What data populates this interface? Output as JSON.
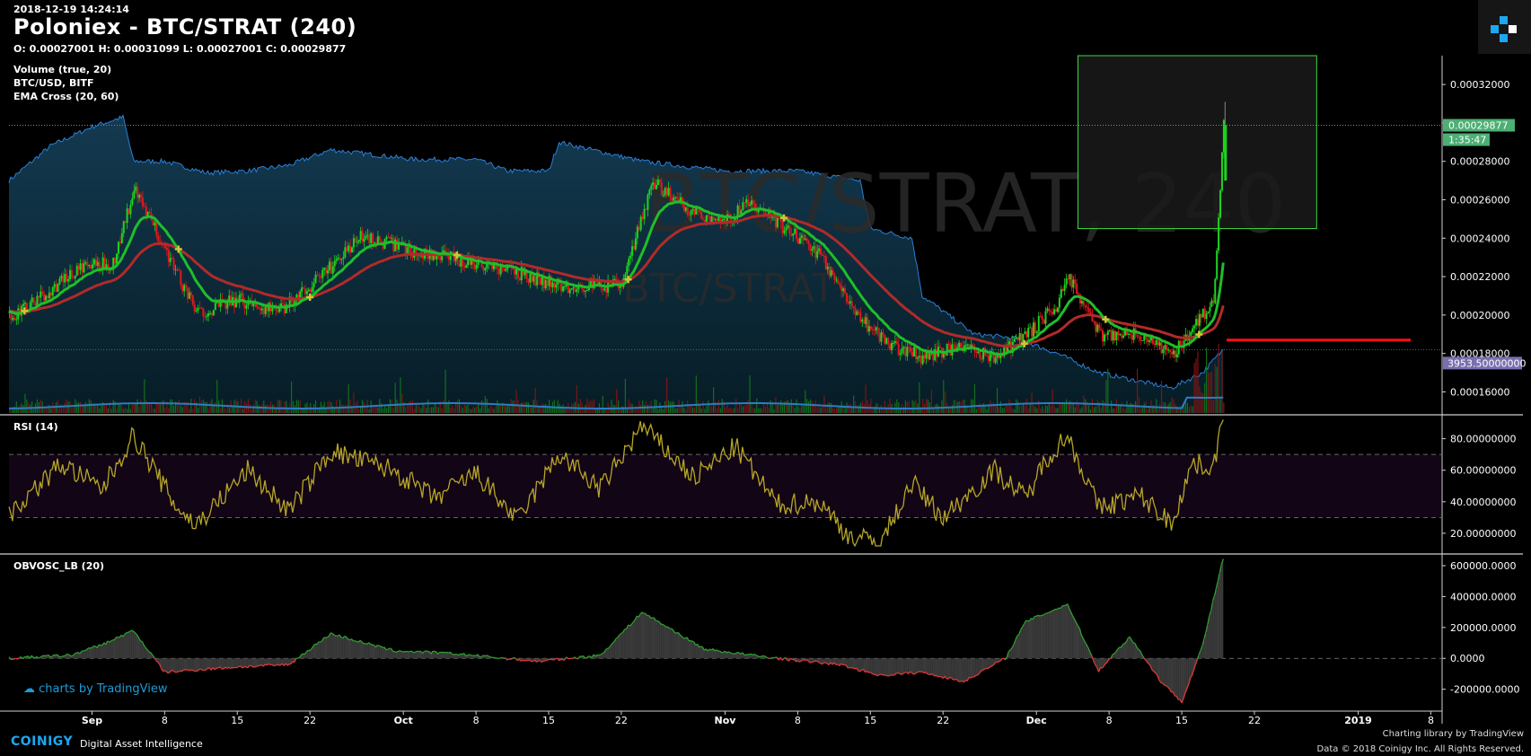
{
  "header": {
    "timestamp": "2018-12-19 14:24:14",
    "title": "Poloniex - BTC/STRAT (240)",
    "ohlc": "O: 0.00027001 H: 0.00031099 L: 0.00027001 C: 0.00029877"
  },
  "indicators": {
    "volume": "Volume (true, 20)",
    "overlay": "BTC/USD, BITF",
    "ema": "EMA Cross (20, 60)",
    "rsi": "RSI (14)",
    "obv": "OBVOSC_LB (20)"
  },
  "watermark": {
    "big": "BTC/STRAT, 240",
    "small": "BTC/STRAT"
  },
  "labels": {
    "last_price": "0.00029877",
    "countdown": "1:35:47",
    "overlay_value": "3953.50000000"
  },
  "footer": {
    "brand": "COINIGY",
    "tagline": "Digital Asset Intelligence",
    "charting_library": "Charting library by  TradingView",
    "copyright": "Data © 2018  Coinigy Inc. All Rights Reserved.",
    "tv_badge": "charts by TradingView"
  },
  "colors": {
    "background": "#000000",
    "up": "#1ed31e",
    "down": "#e0191c",
    "ema_fast": "#1fbe2a",
    "ema_slow": "#b22a2a",
    "overlay_line": "#2b7fd6",
    "rsi_line": "#b7a628",
    "highlight_box": "#3ddc3d",
    "resistance": "#ff1010",
    "price_label": "#4caf73",
    "overlay_label": "#7a6fae"
  },
  "chart_data": [
    {
      "type": "candlestick",
      "title": "Poloniex - BTC/STRAT (240)",
      "x_ticks": [
        "Sep",
        "8",
        "15",
        "22",
        "Oct",
        "8",
        "15",
        "22",
        "Nov",
        "8",
        "15",
        "22",
        "Dec",
        "8",
        "15",
        "22",
        "2019",
        "8"
      ],
      "y_ticks": [
        "0.00032000",
        "0.00030000",
        "0.00028000",
        "0.00026000",
        "0.00024000",
        "0.00022000",
        "0.00020000",
        "0.00018000",
        "0.00016000"
      ],
      "ylim": [
        0.000149,
        0.000335
      ],
      "x_range": [
        "2018-08-24",
        "2019-01-09"
      ],
      "close_anchors": [
        {
          "x": "2018-08-25",
          "y": 0.000201
        },
        {
          "x": "2018-08-31",
          "y": 0.000225
        },
        {
          "x": "2018-09-03",
          "y": 0.000227
        },
        {
          "x": "2018-09-05",
          "y": 0.000265
        },
        {
          "x": "2018-09-08",
          "y": 0.000235
        },
        {
          "x": "2018-09-11",
          "y": 0.000201
        },
        {
          "x": "2018-09-15",
          "y": 0.000208
        },
        {
          "x": "2018-09-19",
          "y": 0.000202
        },
        {
          "x": "2018-09-23",
          "y": 0.00022
        },
        {
          "x": "2018-09-27",
          "y": 0.000241
        },
        {
          "x": "2018-10-02",
          "y": 0.000233
        },
        {
          "x": "2018-10-08",
          "y": 0.000227
        },
        {
          "x": "2018-10-12",
          "y": 0.000222
        },
        {
          "x": "2018-10-16",
          "y": 0.000215
        },
        {
          "x": "2018-10-22",
          "y": 0.000215
        },
        {
          "x": "2018-10-25",
          "y": 0.00027
        },
        {
          "x": "2018-10-28",
          "y": 0.000256
        },
        {
          "x": "2018-11-01",
          "y": 0.000248
        },
        {
          "x": "2018-11-03",
          "y": 0.000258
        },
        {
          "x": "2018-11-06",
          "y": 0.000248
        },
        {
          "x": "2018-11-10",
          "y": 0.000232
        },
        {
          "x": "2018-11-14",
          "y": 0.000198
        },
        {
          "x": "2018-11-17",
          "y": 0.000184
        },
        {
          "x": "2018-11-20",
          "y": 0.000178
        },
        {
          "x": "2018-11-23",
          "y": 0.000183
        },
        {
          "x": "2018-11-27",
          "y": 0.000178
        },
        {
          "x": "2018-11-30",
          "y": 0.00019
        },
        {
          "x": "2018-12-03",
          "y": 0.000205
        },
        {
          "x": "2018-12-04",
          "y": 0.000221
        },
        {
          "x": "2018-12-07",
          "y": 0.00019
        },
        {
          "x": "2018-12-11",
          "y": 0.00019
        },
        {
          "x": "2018-12-14",
          "y": 0.000179
        },
        {
          "x": "2018-12-17",
          "y": 0.0002
        },
        {
          "x": "2018-12-18",
          "y": 0.000206
        },
        {
          "x": "2018-12-19",
          "y": 0.000299
        }
      ],
      "last_price": 0.00029877,
      "resistance_level": 0.000187,
      "highlight_zone": {
        "x_from": "2018-12-05",
        "x_to": "2018-12-28",
        "y_from": 0.000245,
        "y_to": 0.000335
      }
    },
    {
      "type": "line",
      "name": "BTC/USD, BITF",
      "last_value": 3953.5,
      "note": "scaled overlay of BTC/USD price drawn on the price pane"
    },
    {
      "type": "line",
      "title": "RSI (14)",
      "y_ticks": [
        "80.00000000",
        "60.00000000",
        "40.00000000",
        "20.00000000"
      ],
      "ylim": [
        8,
        94
      ],
      "bands": [
        30,
        70
      ],
      "anchors": [
        {
          "x": "2018-08-24",
          "y": 32
        },
        {
          "x": "2018-08-29",
          "y": 64
        },
        {
          "x": "2018-09-02",
          "y": 48
        },
        {
          "x": "2018-09-05",
          "y": 82
        },
        {
          "x": "2018-09-09",
          "y": 38
        },
        {
          "x": "2018-09-11",
          "y": 25
        },
        {
          "x": "2018-09-16",
          "y": 60
        },
        {
          "x": "2018-09-20",
          "y": 34
        },
        {
          "x": "2018-09-24",
          "y": 72
        },
        {
          "x": "2018-09-30",
          "y": 60
        },
        {
          "x": "2018-10-04",
          "y": 42
        },
        {
          "x": "2018-10-08",
          "y": 58
        },
        {
          "x": "2018-10-12",
          "y": 28
        },
        {
          "x": "2018-10-16",
          "y": 70
        },
        {
          "x": "2018-10-20",
          "y": 48
        },
        {
          "x": "2018-10-24",
          "y": 88
        },
        {
          "x": "2018-10-29",
          "y": 55
        },
        {
          "x": "2018-11-02",
          "y": 75
        },
        {
          "x": "2018-11-06",
          "y": 38
        },
        {
          "x": "2018-11-10",
          "y": 40
        },
        {
          "x": "2018-11-13",
          "y": 18
        },
        {
          "x": "2018-11-16",
          "y": 14
        },
        {
          "x": "2018-11-19",
          "y": 52
        },
        {
          "x": "2018-11-22",
          "y": 30
        },
        {
          "x": "2018-11-27",
          "y": 60
        },
        {
          "x": "2018-11-30",
          "y": 42
        },
        {
          "x": "2018-12-02",
          "y": 68
        },
        {
          "x": "2018-12-04",
          "y": 82
        },
        {
          "x": "2018-12-07",
          "y": 36
        },
        {
          "x": "2018-12-11",
          "y": 44
        },
        {
          "x": "2018-12-14",
          "y": 26
        },
        {
          "x": "2018-12-16",
          "y": 64
        },
        {
          "x": "2018-12-18",
          "y": 62
        },
        {
          "x": "2018-12-19",
          "y": 92
        }
      ]
    },
    {
      "type": "area",
      "title": "OBVOSC_LB (20)",
      "y_ticks": [
        "600000.0000",
        "400000.0000",
        "200000.0000",
        "0.0000",
        "-200000.0000"
      ],
      "ylim": [
        -330000,
        670000
      ],
      "anchors": [
        {
          "x": "2018-08-24",
          "y": 0
        },
        {
          "x": "2018-08-30",
          "y": 20000
        },
        {
          "x": "2018-09-02",
          "y": 90000
        },
        {
          "x": "2018-09-05",
          "y": 180000
        },
        {
          "x": "2018-09-08",
          "y": -90000
        },
        {
          "x": "2018-09-14",
          "y": -60000
        },
        {
          "x": "2018-09-20",
          "y": -40000
        },
        {
          "x": "2018-09-24",
          "y": 160000
        },
        {
          "x": "2018-09-30",
          "y": 50000
        },
        {
          "x": "2018-10-06",
          "y": 30000
        },
        {
          "x": "2018-10-14",
          "y": -20000
        },
        {
          "x": "2018-10-20",
          "y": 20000
        },
        {
          "x": "2018-10-24",
          "y": 300000
        },
        {
          "x": "2018-10-30",
          "y": 60000
        },
        {
          "x": "2018-11-06",
          "y": 0
        },
        {
          "x": "2018-11-12",
          "y": -40000
        },
        {
          "x": "2018-11-16",
          "y": -110000
        },
        {
          "x": "2018-11-20",
          "y": -90000
        },
        {
          "x": "2018-11-24",
          "y": -150000
        },
        {
          "x": "2018-11-28",
          "y": 0
        },
        {
          "x": "2018-11-30",
          "y": 240000
        },
        {
          "x": "2018-12-04",
          "y": 350000
        },
        {
          "x": "2018-12-07",
          "y": -80000
        },
        {
          "x": "2018-12-10",
          "y": 140000
        },
        {
          "x": "2018-12-13",
          "y": -150000
        },
        {
          "x": "2018-12-15",
          "y": -280000
        },
        {
          "x": "2018-12-17",
          "y": 80000
        },
        {
          "x": "2018-12-19",
          "y": 650000
        }
      ]
    }
  ]
}
